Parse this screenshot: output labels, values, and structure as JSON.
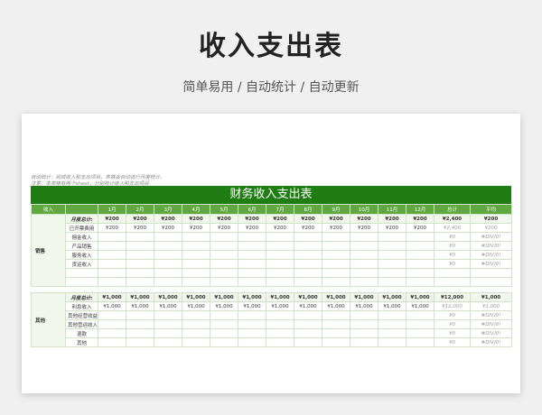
{
  "title": "收入支出表",
  "subtitle": "简单易用  /  自动统计  /  自动更新",
  "sheet": {
    "note1": "自动统计：完成收入和支出项目，表格会自动进行月度统计。",
    "note2": "注意：本表格有两个sheet，分别统计收入和支出项目",
    "banner": "财务收入支出表",
    "headers": [
      "收入",
      "",
      "1月",
      "2月",
      "3月",
      "4月",
      "5月",
      "6月",
      "7月",
      "8月",
      "9月",
      "10月",
      "11月",
      "12月",
      "总计",
      "平均"
    ],
    "income_group": "销售",
    "income_rows": [
      {
        "label": "月度总计:",
        "values": [
          "¥200",
          "¥200",
          "¥200",
          "¥200",
          "¥200",
          "¥200",
          "¥200",
          "¥200",
          "¥200",
          "¥200",
          "¥200",
          "¥200"
        ],
        "total": "¥2,400",
        "avg": "¥200"
      },
      {
        "label": "已开票费用",
        "values": [
          "¥200",
          "¥200",
          "¥200",
          "¥200",
          "¥200",
          "¥200",
          "¥200",
          "¥200",
          "¥200",
          "¥200",
          "¥200",
          "¥200"
        ],
        "total": "¥2,400",
        "avg": "¥200"
      },
      {
        "label": "佣金收入",
        "values": [
          "",
          "",
          "",
          "",
          "",
          "",
          "",
          "",
          "",
          "",
          "",
          ""
        ],
        "total": "¥0",
        "avg": "#DIV/0!"
      },
      {
        "label": "产品销售",
        "values": [
          "",
          "",
          "",
          "",
          "",
          "",
          "",
          "",
          "",
          "",
          "",
          ""
        ],
        "total": "¥0",
        "avg": "#DIV/0!"
      },
      {
        "label": "服务收入",
        "values": [
          "",
          "",
          "",
          "",
          "",
          "",
          "",
          "",
          "",
          "",
          "",
          ""
        ],
        "total": "¥0",
        "avg": "#DIV/0!"
      },
      {
        "label": "货运收入",
        "values": [
          "",
          "",
          "",
          "",
          "",
          "",
          "",
          "",
          "",
          "",
          "",
          ""
        ],
        "total": "¥0",
        "avg": "#DIV/0!"
      },
      {
        "label": "",
        "values": [
          "",
          "",
          "",
          "",
          "",
          "",
          "",
          "",
          "",
          "",
          "",
          ""
        ],
        "total": "",
        "avg": ""
      },
      {
        "label": "",
        "values": [
          "",
          "",
          "",
          "",
          "",
          "",
          "",
          "",
          "",
          "",
          "",
          ""
        ],
        "total": "",
        "avg": ""
      }
    ],
    "other_group": "其他",
    "other_rows": [
      {
        "label": "月度总计:",
        "values": [
          "¥1,000",
          "¥1,000",
          "¥1,000",
          "¥1,000",
          "¥1,000",
          "¥1,000",
          "¥1,000",
          "¥1,000",
          "¥1,000",
          "¥1,000",
          "¥1,000",
          "¥1,000"
        ],
        "total": "¥12,000",
        "avg": "¥1,000"
      },
      {
        "label": "利息收入",
        "values": [
          "¥1,000",
          "¥1,000",
          "¥1,000",
          "¥1,000",
          "¥1,000",
          "¥1,000",
          "¥1,000",
          "¥1,000",
          "¥1,000",
          "¥1,000",
          "¥1,000",
          "¥1,000"
        ],
        "total": "¥12,000",
        "avg": "¥1,000"
      },
      {
        "label": "其他经营收益收入",
        "values": [
          "",
          "",
          "",
          "",
          "",
          "",
          "",
          "",
          "",
          "",
          "",
          ""
        ],
        "total": "¥0",
        "avg": "#DIV/0!"
      },
      {
        "label": "其他营运收入",
        "values": [
          "",
          "",
          "",
          "",
          "",
          "",
          "",
          "",
          "",
          "",
          "",
          ""
        ],
        "total": "¥0",
        "avg": "#DIV/0!"
      },
      {
        "label": "退款",
        "values": [
          "",
          "",
          "",
          "",
          "",
          "",
          "",
          "",
          "",
          "",
          "",
          ""
        ],
        "total": "¥0",
        "avg": "#DIV/0!"
      },
      {
        "label": "其他",
        "values": [
          "",
          "",
          "",
          "",
          "",
          "",
          "",
          "",
          "",
          "",
          "",
          ""
        ],
        "total": "¥0",
        "avg": "#DIV/0!"
      }
    ]
  }
}
